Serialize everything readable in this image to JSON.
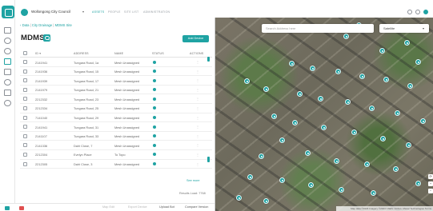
{
  "header": {
    "council": "Wollongong City Council",
    "nav": [
      {
        "label": "ASSETS"
      },
      {
        "label": "PEOPLE"
      },
      {
        "label": "SITE LIST"
      },
      {
        "label": "ADMINISTRATION"
      }
    ]
  },
  "breadcrumb": {
    "home": "Data",
    "mid": "City Drainage",
    "current": "MDMS Site"
  },
  "page": {
    "title": "MDMS",
    "add_button": "Add Device"
  },
  "table": {
    "columns": [
      "ID",
      "ADDRESS",
      "NAME",
      "STATUS",
      "ACTIONS"
    ],
    "rows": [
      {
        "id": "2141941",
        "address": "Tungara Road, 1a",
        "name": "Mesh Unassigned"
      },
      {
        "id": "2141936",
        "address": "Tungara Road, 15",
        "name": "Mesh Unassigned"
      },
      {
        "id": "2141939",
        "address": "Tungara Road, 17",
        "name": "Mesh Unassigned"
      },
      {
        "id": "2141979",
        "address": "Tungara Road, 21",
        "name": "Mesh Unassigned"
      },
      {
        "id": "2212332",
        "address": "Tungara Road, 23",
        "name": "Mesh Unassigned"
      },
      {
        "id": "2212334",
        "address": "Tungara Road, 25",
        "name": "Mesh Unassigned"
      },
      {
        "id": "7141040",
        "address": "Tungara Road, 29",
        "name": "Mesh Unassigned"
      },
      {
        "id": "2141941",
        "address": "Tungara Road, 31",
        "name": "Mesh Unassigned"
      },
      {
        "id": "2141107",
        "address": "Tungara Road, 33",
        "name": "Mesh Unassigned"
      },
      {
        "id": "2141336",
        "address": "Dalri Close, 7",
        "name": "Mesh Unassigned"
      },
      {
        "id": "2212304",
        "address": "Evelyn Place",
        "name": "To Topo"
      },
      {
        "id": "2212305",
        "address": "Dalri Close, 3",
        "name": "Mesh Unassigned"
      }
    ],
    "see_more": "See more",
    "results": "Results Load: 7768"
  },
  "bottombar": {
    "buttons": [
      "Map Edit",
      "Export Device",
      "Upload Bot",
      "Compare Version"
    ]
  },
  "map": {
    "search_placeholder": "Search Address here",
    "map_type": "Satellite",
    "attribution": "Map data ©2023 Imagery ©2023 CNES / Airbus, Maxar Technologies Terms"
  },
  "colors": {
    "accent": "#1fa3a3",
    "danger": "#e05050"
  }
}
